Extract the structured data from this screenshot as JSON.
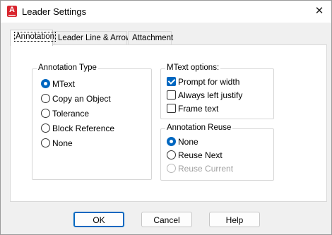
{
  "window": {
    "title": "Leader Settings",
    "close_glyph": "✕",
    "app_icon_glyph": "A"
  },
  "tabs": [
    {
      "label": "Annotation",
      "active": true
    },
    {
      "label": "Leader Line & Arrow",
      "active": false
    },
    {
      "label": "Attachment",
      "active": false
    }
  ],
  "annotation_type": {
    "legend": "Annotation Type",
    "options": [
      {
        "label": "MText",
        "checked": true
      },
      {
        "label": "Copy an Object",
        "checked": false
      },
      {
        "label": "Tolerance",
        "checked": false
      },
      {
        "label": "Block Reference",
        "checked": false
      },
      {
        "label": "None",
        "checked": false
      }
    ]
  },
  "mtext_options": {
    "legend": "MText options:",
    "options": [
      {
        "label": "Prompt for width",
        "checked": true
      },
      {
        "label": "Always left justify",
        "checked": false
      },
      {
        "label": "Frame text",
        "checked": false
      }
    ]
  },
  "annotation_reuse": {
    "legend": "Annotation Reuse",
    "options": [
      {
        "label": "None",
        "checked": true,
        "disabled": false
      },
      {
        "label": "Reuse Next",
        "checked": false,
        "disabled": false
      },
      {
        "label": "Reuse Current",
        "checked": false,
        "disabled": true
      }
    ]
  },
  "buttons": {
    "ok": "OK",
    "cancel": "Cancel",
    "help": "Help"
  },
  "colors": {
    "accent": "#0067c0",
    "app_icon": "#d9262f"
  }
}
